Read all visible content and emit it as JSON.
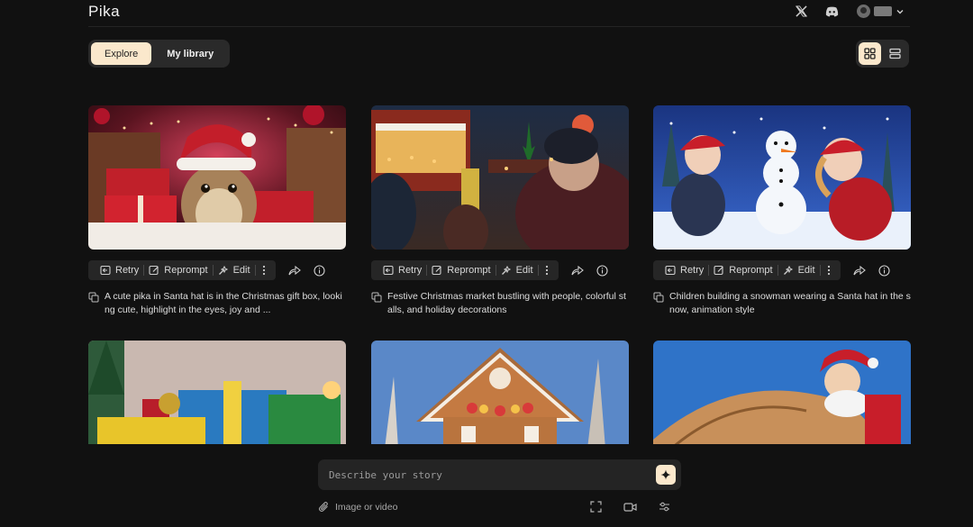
{
  "app": {
    "logo": "Pika"
  },
  "header": {
    "icons": [
      "x-icon",
      "discord-icon",
      "avatar",
      "chevron-down-icon"
    ]
  },
  "tabs": [
    {
      "label": "Explore",
      "active": true
    },
    {
      "label": "My library",
      "active": false
    }
  ],
  "view_toggle": {
    "active": "grid",
    "options": [
      "grid-view-icon",
      "list-view-icon"
    ]
  },
  "actions": {
    "retry": "Retry",
    "reprompt": "Reprompt",
    "edit": "Edit"
  },
  "cards": [
    {
      "description": "A cute pika in Santa hat is in the Christmas gift box, looking cute, highlight in the eyes, joy and ..."
    },
    {
      "description": "Festive Christmas market bustling with people, colorful stalls, and holiday decorations"
    },
    {
      "description": "Children building a snowman wearing a Santa hat in the snow, animation style"
    },
    {
      "description": ""
    },
    {
      "description": ""
    },
    {
      "description": ""
    }
  ],
  "prompt": {
    "placeholder": "Describe your story",
    "attach_label": "Image or video"
  },
  "colors": {
    "background": "#111111",
    "accent": "#fbe8cc",
    "surface": "#2a2a2a"
  }
}
